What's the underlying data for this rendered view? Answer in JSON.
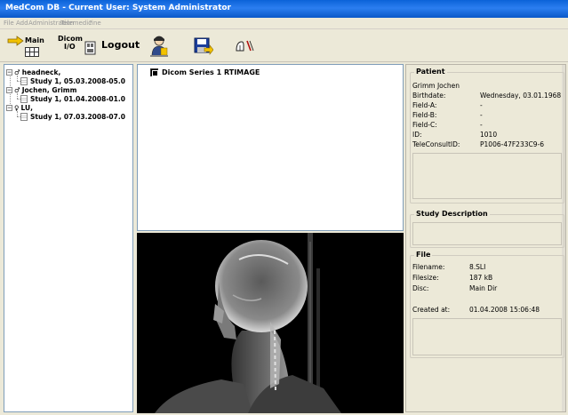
{
  "window": {
    "title": "MedCom DB - Current User: System Administrator"
  },
  "menu": [
    "File",
    "Add",
    "Administration",
    "Telemedicine",
    "?"
  ],
  "toolbar": {
    "main_label": "Main",
    "dicom_label_1": "Dicom",
    "dicom_label_2": "I/O",
    "logout_label": "Logout"
  },
  "tree": {
    "items": [
      {
        "symbol": "♂",
        "label": "headneck,",
        "child": "Study 1, 05.03.2008-05.0"
      },
      {
        "symbol": "♂",
        "label": "Jochen, Grimm",
        "child": "Study 1, 01.04.2008-01.0"
      },
      {
        "symbol": "♀",
        "label": "LU,",
        "child": "Study 1, 07.03.2008-07.0"
      }
    ]
  },
  "series": {
    "label": "Dicom Series 1 RTIMAGE"
  },
  "patient": {
    "title": "Patient",
    "name": "Grimm Jochen",
    "fields": [
      {
        "key": "Birthdate:",
        "value": "Wednesday, 03.01.1968"
      },
      {
        "key": "Field-A:",
        "value": "-"
      },
      {
        "key": "Field-B:",
        "value": "-"
      },
      {
        "key": "Field-C:",
        "value": "-"
      },
      {
        "key": "ID:",
        "value": "1010"
      },
      {
        "key": "TeleConsultID:",
        "value": "P1006-47F233C9-6"
      }
    ]
  },
  "study": {
    "title": "Study Description"
  },
  "file": {
    "title": "File",
    "fields": [
      {
        "key": "Filename:",
        "value": "8.SLI"
      },
      {
        "key": "Filesize:",
        "value": "187 kB"
      },
      {
        "key": "Disc:",
        "value": "Main Dir"
      }
    ],
    "created_key": "Created at:",
    "created_value": "01.04.2008 15:06:48"
  }
}
